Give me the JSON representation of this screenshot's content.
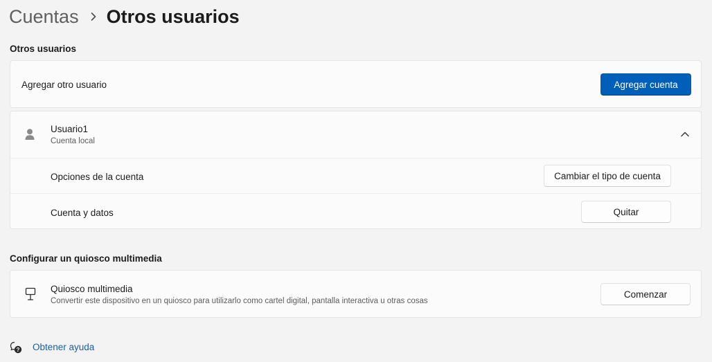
{
  "breadcrumb": {
    "parent": "Cuentas",
    "separator_icon": "chevron-right-icon",
    "current": "Otros usuarios"
  },
  "other_users": {
    "heading": "Otros usuarios",
    "add_user": {
      "label": "Agregar otro usuario",
      "button_label": "Agregar cuenta"
    },
    "user": {
      "icon": "person-icon",
      "name": "Usuario1",
      "type": "Cuenta local",
      "expand_icon": "chevron-up-icon",
      "account_options_label": "Opciones de la cuenta",
      "change_type_button": "Cambiar el tipo de cuenta",
      "account_data_label": "Cuenta y datos",
      "remove_button": "Quitar"
    }
  },
  "kiosk": {
    "heading": "Configurar un quiosco multimedia",
    "icon": "kiosk-icon",
    "title": "Quiosco multimedia",
    "description": "Convertir este dispositivo en un quiosco para utilizarlo como cartel digital, pantalla interactiva u otras cosas",
    "button_label": "Comenzar"
  },
  "help": {
    "icon": "help-icon",
    "label": "Obtener ayuda"
  },
  "colors": {
    "background": "#f3f3f3",
    "card": "#fbfbfb",
    "accent": "#005fb8",
    "link": "#1a5fa8"
  }
}
